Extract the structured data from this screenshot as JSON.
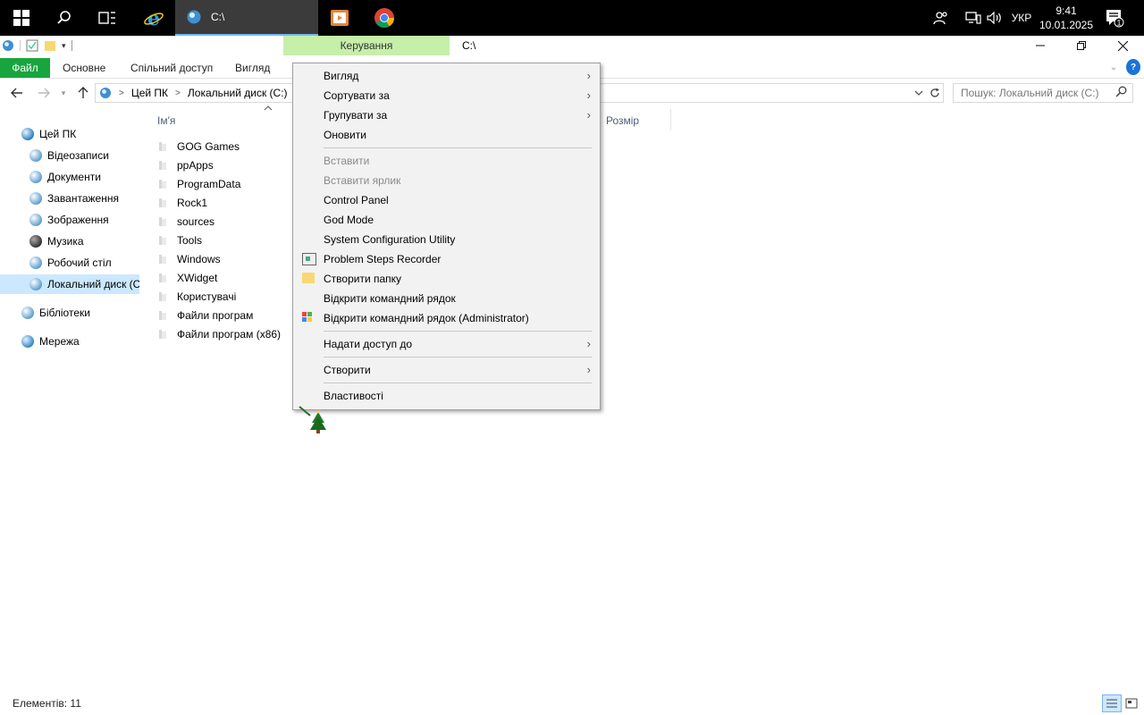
{
  "taskbar": {
    "explorer_label": "C:\\",
    "language": "УКР",
    "time": "9:41",
    "date": "10.01.2025",
    "notification_count": "1",
    "icons": [
      "windows-start-icon",
      "search-icon",
      "task-view-icon",
      "internet-explorer-icon",
      "media-player-icon",
      "chrome-icon",
      "people-icon",
      "network-icon",
      "volume-icon",
      "notification-icon"
    ]
  },
  "window": {
    "title": "C:\\",
    "context_tab_header": "Керування"
  },
  "ribbon": {
    "tabs": [
      "Файл",
      "Основне",
      "Спільний доступ",
      "Вигляд"
    ],
    "file_tab_color": "#19a53d"
  },
  "address": {
    "crumbs": [
      "Цей ПК",
      "Локальний диск (C:)"
    ]
  },
  "search": {
    "placeholder": "Пошук: Локальний диск (C:)"
  },
  "nav": {
    "items": [
      {
        "label": "Цей ПК",
        "icon": "this-pc-icon"
      },
      {
        "label": "Відеозаписи",
        "icon": "videos-icon"
      },
      {
        "label": "Документи",
        "icon": "documents-icon"
      },
      {
        "label": "Завантаження",
        "icon": "downloads-icon"
      },
      {
        "label": "Зображення",
        "icon": "pictures-icon"
      },
      {
        "label": "Музика",
        "icon": "music-icon"
      },
      {
        "label": "Робочий стіл",
        "icon": "desktop-icon"
      },
      {
        "label": "Локальний диск (C:)",
        "icon": "local-disk-icon"
      },
      {
        "label": "Бібліотеки",
        "icon": "libraries-icon"
      },
      {
        "label": "Мережа",
        "icon": "network-icon"
      }
    ]
  },
  "columns": {
    "name": "Ім'я",
    "size": "Розмір"
  },
  "files": [
    "GOG Games",
    "ppApps",
    "ProgramData",
    "Rock1",
    "sources",
    "Tools",
    "Windows",
    "XWidget",
    "Користувачі",
    "Файли програм",
    "Файли програм (x86)"
  ],
  "context_menu": {
    "items": [
      {
        "label": "Вигляд",
        "submenu": true
      },
      {
        "label": "Сортувати за",
        "submenu": true
      },
      {
        "label": "Групувати за",
        "submenu": true
      },
      {
        "label": "Оновити"
      },
      {
        "label": "Вставити",
        "disabled": true
      },
      {
        "label": "Вставити ярлик",
        "disabled": true
      },
      {
        "label": "Control Panel"
      },
      {
        "label": "God Mode"
      },
      {
        "label": "System Configuration Utility"
      },
      {
        "label": "Problem Steps Recorder",
        "icon": "steps-recorder-icon"
      },
      {
        "label": "Створити папку",
        "icon": "new-folder-icon"
      },
      {
        "label": "Відкрити командний рядок"
      },
      {
        "label": "Відкрити командний рядок (Administrator)",
        "icon": "windows-flag-icon"
      },
      {
        "label": "Надати доступ до",
        "submenu": true
      },
      {
        "label": "Створити",
        "submenu": true
      },
      {
        "label": "Властивості"
      }
    ]
  },
  "status": {
    "items_count": "Елементів: 11"
  }
}
